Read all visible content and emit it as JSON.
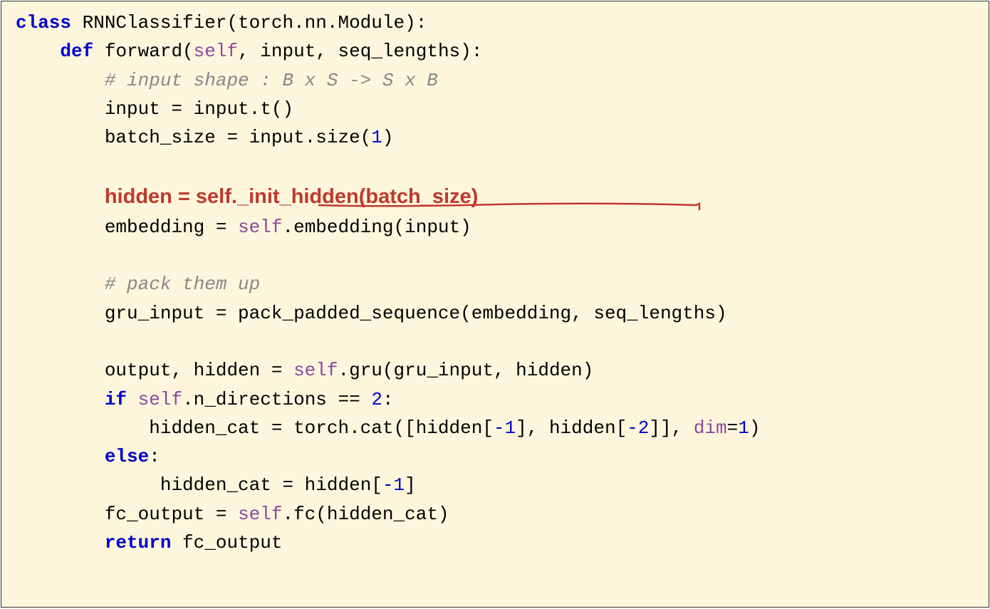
{
  "code": {
    "line1_kw_class": "class",
    "line1_name": " RNNClassifier(torch.nn.Module):",
    "line2_kw_def": "def",
    "line2_fn": " forward(",
    "line2_self": "self",
    "line2_rest": ", input, seq_lengths):",
    "line3_comment": "# input shape : B x S -> S x B",
    "line4": "input = input.t()",
    "line5_a": "batch_size = input.size(",
    "line5_num": "1",
    "line5_b": ")",
    "line7_highlight": "hidden = self._init_hidden(batch_size)",
    "line8_a": "embedding = ",
    "line8_self": "self",
    "line8_b": ".embedding(input)",
    "line10_comment": "# pack them up",
    "line11": "gru_input = pack_padded_sequence(embedding, seq_lengths)",
    "line13_a": "output, hidden = ",
    "line13_self": "self",
    "line13_b": ".gru(gru_input, hidden)",
    "line14_kw_if": "if",
    "line14_sp": " ",
    "line14_self": "self",
    "line14_b": ".n_directions == ",
    "line14_num": "2",
    "line14_c": ":",
    "line15_a": "hidden_cat = torch.cat([hidden[",
    "line15_neg1a": "-1",
    "line15_b": "], hidden[",
    "line15_neg2": "-2",
    "line15_c": "]], ",
    "line15_dim": "dim",
    "line15_eq": "=",
    "line15_dimval": "1",
    "line15_d": ")",
    "line16_kw_else": "else",
    "line16_b": ":",
    "line17_a": "hidden_cat = hidden[",
    "line17_neg1": "-1",
    "line17_b": "]",
    "line18_a": "fc_output = ",
    "line18_self": "self",
    "line18_b": ".fc(hidden_cat)",
    "line19_kw_return": "return",
    "line19_b": " fc_output"
  },
  "colors": {
    "background": "#fdf6dd",
    "keyword": "#0000cc",
    "self": "#8a4a9c",
    "comment": "#888888",
    "highlight": "#c0392b",
    "number": "#0000cc"
  }
}
